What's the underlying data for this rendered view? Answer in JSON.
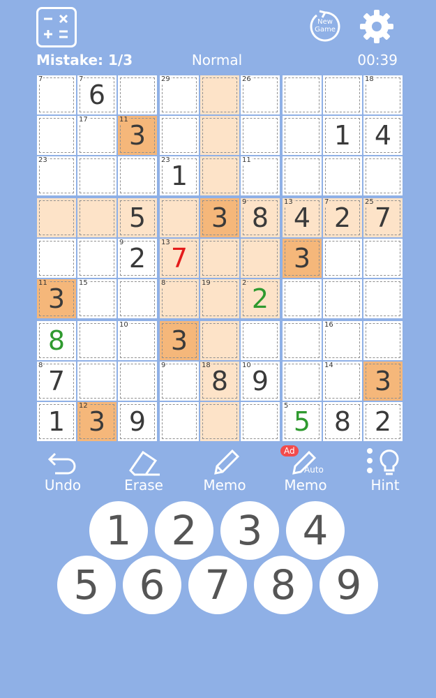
{
  "header": {
    "calculator_icon": "calculator-icon",
    "new_game_label": "New Game",
    "settings_icon": "gear-icon"
  },
  "status": {
    "mistakes": "Mistake: 1/3",
    "difficulty": "Normal",
    "timer": "00:39"
  },
  "board": {
    "rows": [
      [
        {
          "v": "",
          "sum": "7"
        },
        {
          "v": "6",
          "sum": "7"
        },
        {
          "v": ""
        },
        {
          "v": "",
          "sum": "29"
        },
        {
          "v": "",
          "h": "hl"
        },
        {
          "v": "",
          "sum": "26"
        },
        {
          "v": ""
        },
        {
          "v": ""
        },
        {
          "v": "",
          "sum": "18"
        }
      ],
      [
        {
          "v": ""
        },
        {
          "v": "",
          "sum": "17"
        },
        {
          "v": "3",
          "sum": "11",
          "h": "same"
        },
        {
          "v": ""
        },
        {
          "v": "",
          "h": "hl"
        },
        {
          "v": ""
        },
        {
          "v": ""
        },
        {
          "v": "1"
        },
        {
          "v": "4"
        }
      ],
      [
        {
          "v": "",
          "sum": "23"
        },
        {
          "v": ""
        },
        {
          "v": ""
        },
        {
          "v": "1",
          "sum": "23"
        },
        {
          "v": "",
          "h": "hl"
        },
        {
          "v": "",
          "sum": "11"
        },
        {
          "v": ""
        },
        {
          "v": ""
        },
        {
          "v": ""
        }
      ],
      [
        {
          "v": "",
          "h": "hl"
        },
        {
          "v": "",
          "h": "hl"
        },
        {
          "v": "5",
          "h": "hl"
        },
        {
          "v": "",
          "h": "hl"
        },
        {
          "v": "3",
          "h": "same"
        },
        {
          "v": "8",
          "sum": "9",
          "h": "hl"
        },
        {
          "v": "4",
          "sum": "13",
          "h": "hl"
        },
        {
          "v": "2",
          "sum": "7",
          "h": "hl"
        },
        {
          "v": "7",
          "sum": "25",
          "h": "hl"
        }
      ],
      [
        {
          "v": ""
        },
        {
          "v": ""
        },
        {
          "v": "2",
          "sum": "9"
        },
        {
          "v": "7",
          "sum": "13",
          "h": "hl",
          "c": "red"
        },
        {
          "v": "",
          "h": "hl"
        },
        {
          "v": "",
          "h": "hl"
        },
        {
          "v": "3",
          "h": "same"
        },
        {
          "v": ""
        },
        {
          "v": ""
        }
      ],
      [
        {
          "v": "3",
          "sum": "11",
          "h": "same"
        },
        {
          "v": "",
          "sum": "15"
        },
        {
          "v": ""
        },
        {
          "v": "",
          "sum": "8",
          "h": "hl"
        },
        {
          "v": "",
          "sum": "19",
          "h": "hl"
        },
        {
          "v": "2",
          "sum": "2",
          "h": "hl",
          "c": "green"
        },
        {
          "v": ""
        },
        {
          "v": ""
        },
        {
          "v": ""
        }
      ],
      [
        {
          "v": "8",
          "c": "green"
        },
        {
          "v": ""
        },
        {
          "v": "",
          "sum": "10"
        },
        {
          "v": "3",
          "h": "same"
        },
        {
          "v": "",
          "h": "hl"
        },
        {
          "v": ""
        },
        {
          "v": ""
        },
        {
          "v": "",
          "sum": "16"
        },
        {
          "v": ""
        }
      ],
      [
        {
          "v": "7",
          "sum": "8"
        },
        {
          "v": ""
        },
        {
          "v": ""
        },
        {
          "v": "",
          "sum": "9"
        },
        {
          "v": "8",
          "sum": "18",
          "h": "hl"
        },
        {
          "v": "9",
          "sum": "10"
        },
        {
          "v": ""
        },
        {
          "v": "",
          "sum": "14"
        },
        {
          "v": "3",
          "h": "same"
        }
      ],
      [
        {
          "v": "1"
        },
        {
          "v": "3",
          "sum": "12",
          "h": "same"
        },
        {
          "v": "9"
        },
        {
          "v": ""
        },
        {
          "v": "",
          "h": "hl"
        },
        {
          "v": ""
        },
        {
          "v": "5",
          "sum": "5",
          "c": "green"
        },
        {
          "v": "8"
        },
        {
          "v": "2"
        }
      ]
    ]
  },
  "tools": [
    {
      "label": "Undo",
      "icon": "undo-icon"
    },
    {
      "label": "Erase",
      "icon": "eraser-icon"
    },
    {
      "label": "Memo",
      "icon": "pencil-icon"
    },
    {
      "label": "Memo",
      "icon": "auto-pencil-icon",
      "badge": "Ad",
      "sub": "Auto"
    },
    {
      "label": "Hint",
      "icon": "lightbulb-icon"
    }
  ],
  "numpad": [
    "1",
    "2",
    "3",
    "4",
    "5",
    "6",
    "7",
    "8",
    "9"
  ],
  "colors": {
    "background": "#8fb0e6",
    "highlight": "#fde3c8",
    "same_number": "#f5b77a",
    "error": "#e41b1b",
    "correct_entry": "#2f9a2f"
  }
}
